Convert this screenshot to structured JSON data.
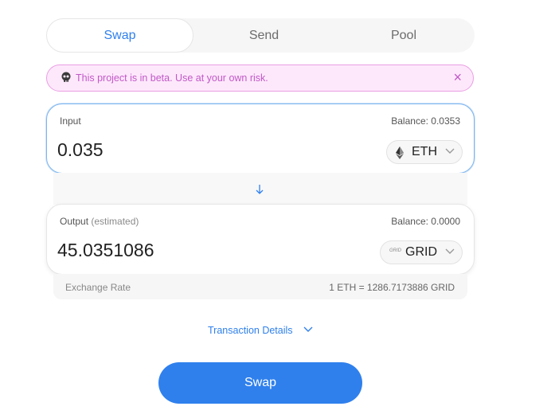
{
  "tabs": [
    {
      "label": "Swap",
      "active": true
    },
    {
      "label": "Send",
      "active": false
    },
    {
      "label": "Pool",
      "active": false
    }
  ],
  "banner": {
    "text": "This project is in beta. Use at your own risk.",
    "icon": "skull-icon",
    "close": "×",
    "color": "#c158c7",
    "background": "#fde8fb"
  },
  "input": {
    "label": "Input",
    "balance": "Balance: 0.0353",
    "amount": "0.035",
    "token": {
      "symbol": "ETH",
      "icon": "ethereum-icon"
    }
  },
  "output": {
    "label": "Output",
    "label_suffix": "(estimated)",
    "balance": "Balance: 0.0000",
    "amount": "45.0351086",
    "token": {
      "symbol": "GRID",
      "icon": "grid-token-icon",
      "icon_text": "GRID"
    }
  },
  "exchange_rate": {
    "label": "Exchange Rate",
    "value": "1 ETH = 1286.7173886 GRID"
  },
  "transaction_details": {
    "label": "Transaction Details"
  },
  "swap_button": {
    "label": "Swap"
  },
  "colors": {
    "accent": "#2f80ed",
    "focus_border": "#7fb6ee"
  }
}
